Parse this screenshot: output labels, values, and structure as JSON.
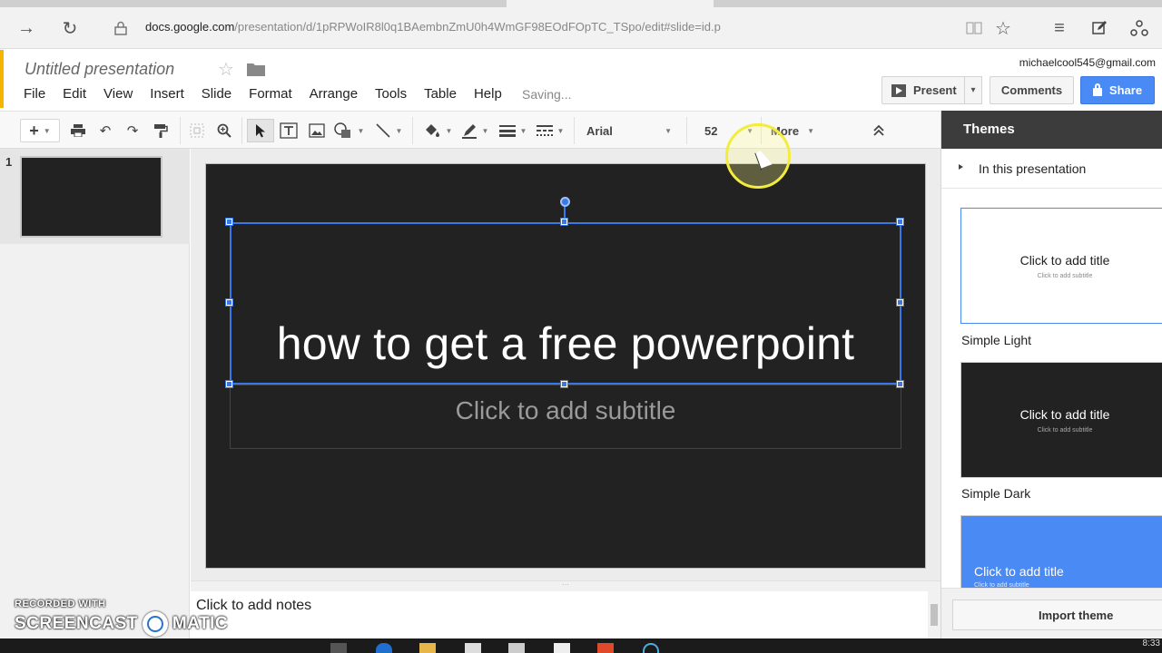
{
  "browser": {
    "url_host": "docs.google.com",
    "url_path": "/presentation/d/1pRPWoIR8l0q1BAembnZmU0h4WmGF98EOdFOpTC_TSpo/edit#slide=id.p"
  },
  "header": {
    "doc_title": "Untitled presentation",
    "save_status": "Saving...",
    "account_email": "michaelcool545@gmail.com",
    "present_label": "Present",
    "comments_label": "Comments",
    "share_label": "Share"
  },
  "menus": [
    "File",
    "Edit",
    "View",
    "Insert",
    "Slide",
    "Format",
    "Arrange",
    "Tools",
    "Table",
    "Help"
  ],
  "toolbar": {
    "new_slide_label": "+",
    "font": "Arial",
    "font_size": "52",
    "more_label": "More"
  },
  "filmstrip": {
    "slide_number": "1"
  },
  "slide": {
    "title": "how to get a free powerpoint",
    "subtitle_placeholder": "Click to add subtitle"
  },
  "notes": {
    "placeholder": "Click to add notes"
  },
  "themes": {
    "header": "Themes",
    "section_label": "In this presentation",
    "items": [
      {
        "name": "Simple Light",
        "preview_title": "Click to add title",
        "preview_subtitle": "Click to add subtitle"
      },
      {
        "name": "Simple Dark",
        "preview_title": "Click to add title",
        "preview_subtitle": "Click to add subtitle"
      },
      {
        "name": "",
        "preview_title": "Click to add title",
        "preview_subtitle": "Click to add subtitle"
      }
    ],
    "import_label": "Import theme"
  },
  "watermark": {
    "line1": "RECORDED WITH",
    "left": "SCREENCAST",
    "right": "MATIC"
  },
  "taskbar": {
    "clock": "8:33"
  },
  "colors": {
    "accent": "#f4b400",
    "share_blue": "#4a8af4",
    "selection": "#3b78e7",
    "slide_bg": "#222222",
    "highlight": "#f3ec3d"
  }
}
